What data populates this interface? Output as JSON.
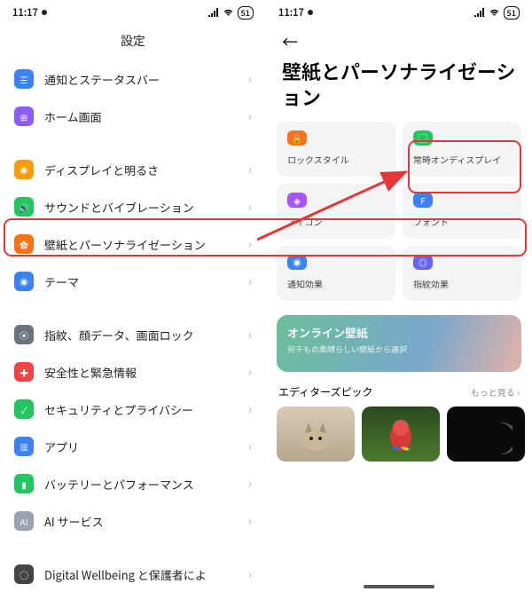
{
  "status": {
    "time": "11:17",
    "battery": "51"
  },
  "left": {
    "title": "設定",
    "items": [
      {
        "label": "通知とステータスバー",
        "color": "#3b82f6"
      },
      {
        "label": "ホーム画面",
        "color": "#8b5cf6"
      },
      {
        "label": "ディスプレイと明るさ",
        "color": "#f59e0b"
      },
      {
        "label": "サウンドとバイブレーション",
        "color": "#22c55e"
      },
      {
        "label": "壁紙とパーソナライゼーション",
        "color": "#f97316"
      },
      {
        "label": "テーマ",
        "color": "#3b82f6"
      },
      {
        "label": "指紋、顔データ、画面ロック",
        "color": "#6b7280"
      },
      {
        "label": "安全性と緊急情報",
        "color": "#ef4444"
      },
      {
        "label": "セキュリティとプライバシー",
        "color": "#22c55e"
      },
      {
        "label": "アプリ",
        "color": "#3b82f6"
      },
      {
        "label": "バッテリーとパフォーマンス",
        "color": "#22c55e"
      },
      {
        "label": "AI サービス",
        "color": "#9ca3af"
      },
      {
        "label": "Digital Wellbeing と保護者によ",
        "color": "#444"
      }
    ]
  },
  "right": {
    "title": "壁紙とパーソナライゼーション",
    "cards": [
      {
        "label": "ロックスタイル",
        "color": "#f97316"
      },
      {
        "label": "常時オンディスプレイ",
        "color": "#22c55e"
      },
      {
        "label": "アイコン",
        "color": "#a855f7"
      },
      {
        "label": "フォント",
        "color": "#3b82f6"
      },
      {
        "label": "通知効果",
        "color": "#3b82f6"
      },
      {
        "label": "指紋効果",
        "color": "#6366f1"
      }
    ],
    "banner": {
      "title": "オンライン壁紙",
      "subtitle": "何千もの素晴らしい壁紙から選択"
    },
    "editors": {
      "title": "エディターズピック",
      "more": "もっと見る"
    }
  }
}
